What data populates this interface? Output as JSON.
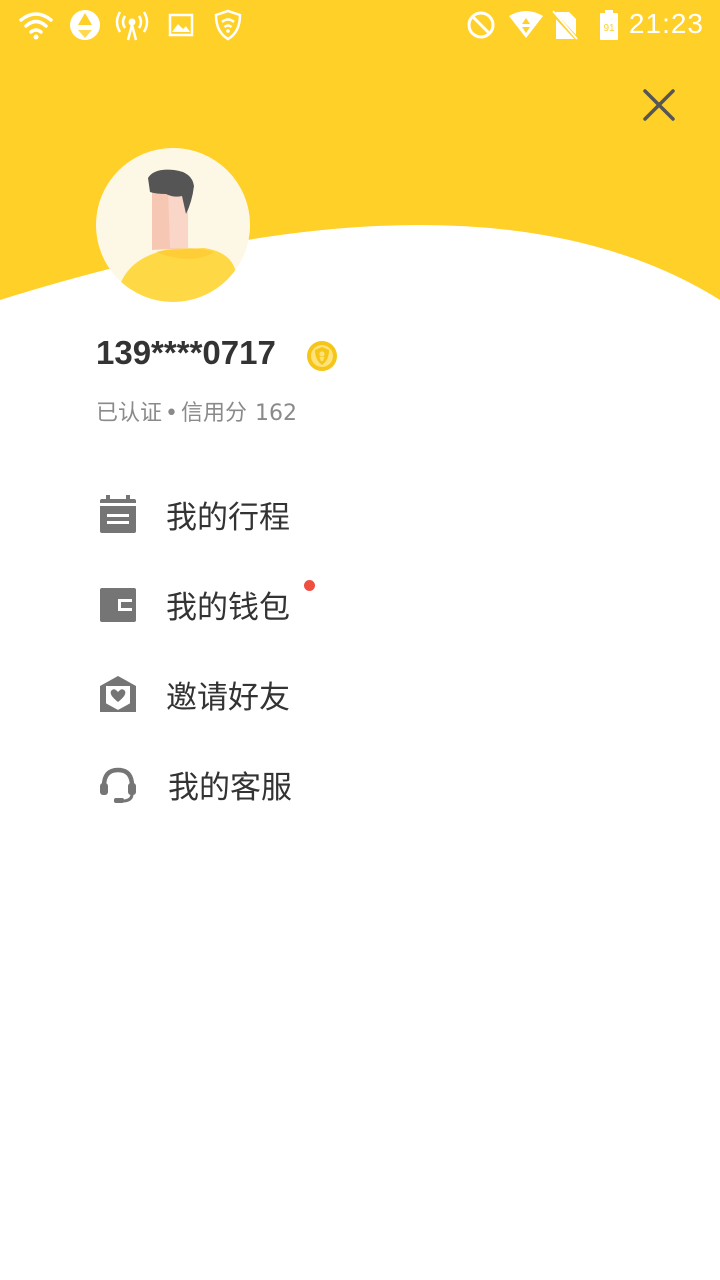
{
  "colors": {
    "header_yellow": "#FFD027",
    "icon_gray": "#757575",
    "text_dark": "#333333",
    "text_gray": "#8A8A8A",
    "badge_gold": "#F5C518",
    "notify_red": "#F04E40"
  },
  "status_bar": {
    "time": "21:23",
    "battery": "91",
    "icons": [
      "wifi-icon",
      "sync-icon",
      "hotspot-icon",
      "image-icon",
      "shield-icon",
      "no-disturb-icon",
      "signal-icon",
      "no-sim-icon",
      "battery-icon"
    ]
  },
  "profile": {
    "phone": "139****0717",
    "verified_label": "已认证",
    "dot": "•",
    "credit_label": "信用分",
    "credit_score": "162"
  },
  "menu": [
    {
      "label": "我的行程",
      "icon": "calendar-icon",
      "has_notification": false
    },
    {
      "label": "我的钱包",
      "icon": "wallet-icon",
      "has_notification": true
    },
    {
      "label": "邀请好友",
      "icon": "invite-heart-icon",
      "has_notification": false
    },
    {
      "label": "我的客服",
      "icon": "headset-icon",
      "has_notification": false
    }
  ]
}
